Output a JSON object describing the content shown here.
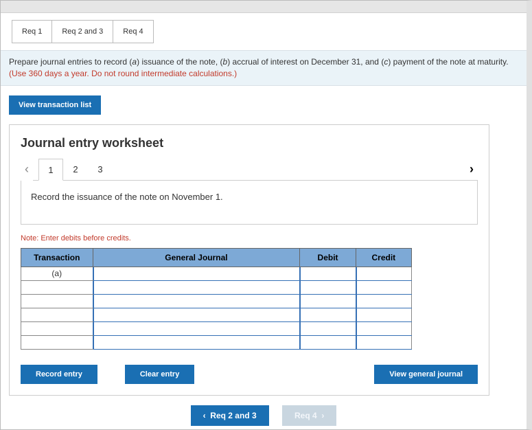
{
  "reqTabs": [
    "Req 1",
    "Req 2 and 3",
    "Req 4"
  ],
  "instruction": {
    "plain": "Prepare journal entries to record (",
    "aItal": "a",
    "a2": ") issuance of the note, (",
    "bItal": "b",
    "b2": ") accrual of interest on December 31, and (",
    "cItal": "c",
    "c2": ") payment of the note at maturity. ",
    "red": "(Use 360 days a year. Do not round intermediate calculations.)"
  },
  "viewTransactionList": "View transaction list",
  "worksheet": {
    "title": "Journal entry worksheet",
    "entryTabs": [
      "1",
      "2",
      "3"
    ],
    "recordText": "Record the issuance of the note on November 1.",
    "note": "Note: Enter debits before credits.",
    "headers": {
      "transaction": "Transaction",
      "gj": "General Journal",
      "debit": "Debit",
      "credit": "Credit"
    },
    "transLabel": "(a)",
    "buttons": {
      "record": "Record entry",
      "clear": "Clear entry",
      "viewGJ": "View general journal"
    }
  },
  "bottomNav": {
    "prev": "Req 2 and 3",
    "next": "Req 4"
  }
}
